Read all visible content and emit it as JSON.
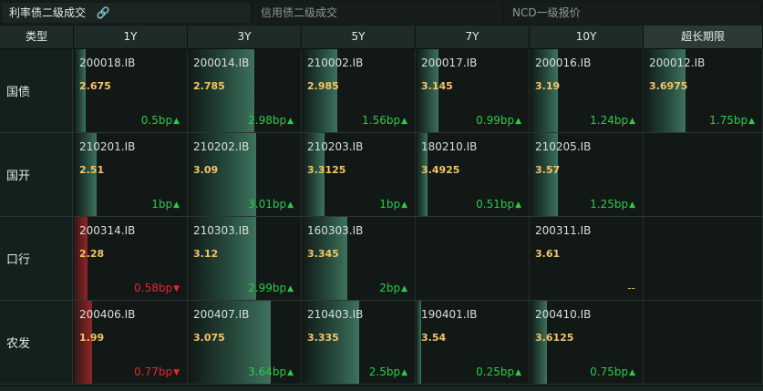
{
  "tabs": [
    {
      "label": "利率债二级成交",
      "active": true,
      "icon": "link-icon"
    },
    {
      "label": "信用债二级成交",
      "active": false
    },
    {
      "label": "NCD一级报价",
      "active": false
    }
  ],
  "table": {
    "corner": "类型",
    "columns": [
      "1Y",
      "3Y",
      "5Y",
      "7Y",
      "10Y",
      "超长期限"
    ],
    "rows": [
      {
        "label": "国债",
        "cells": [
          {
            "code": "200018.IB",
            "yield": "2.675",
            "change": "0.5bp",
            "dir": "up",
            "level": 0.1
          },
          {
            "code": "200014.IB",
            "yield": "2.785",
            "change": "2.98bp",
            "dir": "up",
            "level": 0.58
          },
          {
            "code": "210002.IB",
            "yield": "2.985",
            "change": "1.56bp",
            "dir": "up",
            "level": 0.31
          },
          {
            "code": "200017.IB",
            "yield": "3.145",
            "change": "0.99bp",
            "dir": "up",
            "level": 0.2
          },
          {
            "code": "200016.IB",
            "yield": "3.19",
            "change": "1.24bp",
            "dir": "up",
            "level": 0.25
          },
          {
            "code": "200012.IB",
            "yield": "3.6975",
            "change": "1.75bp",
            "dir": "up",
            "level": 0.35
          }
        ]
      },
      {
        "label": "国开",
        "cells": [
          {
            "code": "210201.IB",
            "yield": "2.51",
            "change": "1bp",
            "dir": "up",
            "level": 0.2
          },
          {
            "code": "210202.IB",
            "yield": "3.09",
            "change": "3.01bp",
            "dir": "up",
            "level": 0.6
          },
          {
            "code": "210203.IB",
            "yield": "3.3125",
            "change": "1bp",
            "dir": "up",
            "level": 0.2
          },
          {
            "code": "180210.IB",
            "yield": "3.4925",
            "change": "0.51bp",
            "dir": "up",
            "level": 0.1
          },
          {
            "code": "210205.IB",
            "yield": "3.57",
            "change": "1.25bp",
            "dir": "up",
            "level": 0.25
          },
          null
        ]
      },
      {
        "label": "口行",
        "cells": [
          {
            "code": "200314.IB",
            "yield": "2.28",
            "change": "0.58bp",
            "dir": "down",
            "level": 0.12
          },
          {
            "code": "210303.IB",
            "yield": "3.12",
            "change": "2.99bp",
            "dir": "up",
            "level": 0.6
          },
          {
            "code": "160303.IB",
            "yield": "3.345",
            "change": "2bp",
            "dir": "up",
            "level": 0.4
          },
          null,
          {
            "code": "200311.IB",
            "yield": "3.61",
            "change": "--",
            "dir": "flat",
            "level": 0
          },
          null
        ]
      },
      {
        "label": "农发",
        "cells": [
          {
            "code": "200406.IB",
            "yield": "1.99",
            "change": "0.77bp",
            "dir": "down",
            "level": 0.16
          },
          {
            "code": "200407.IB",
            "yield": "3.075",
            "change": "3.64bp",
            "dir": "up",
            "level": 0.73
          },
          {
            "code": "210403.IB",
            "yield": "3.335",
            "change": "2.5bp",
            "dir": "up",
            "level": 0.5
          },
          {
            "code": "190401.IB",
            "yield": "3.54",
            "change": "0.25bp",
            "dir": "up",
            "level": 0.05
          },
          {
            "code": "200410.IB",
            "yield": "3.6125",
            "change": "0.75bp",
            "dir": "up",
            "level": 0.15
          },
          null
        ]
      }
    ]
  },
  "colors": {
    "up": "#2ec94a",
    "down": "#e8272c",
    "yield": "#f5c463",
    "flat": "#d8b35a"
  }
}
